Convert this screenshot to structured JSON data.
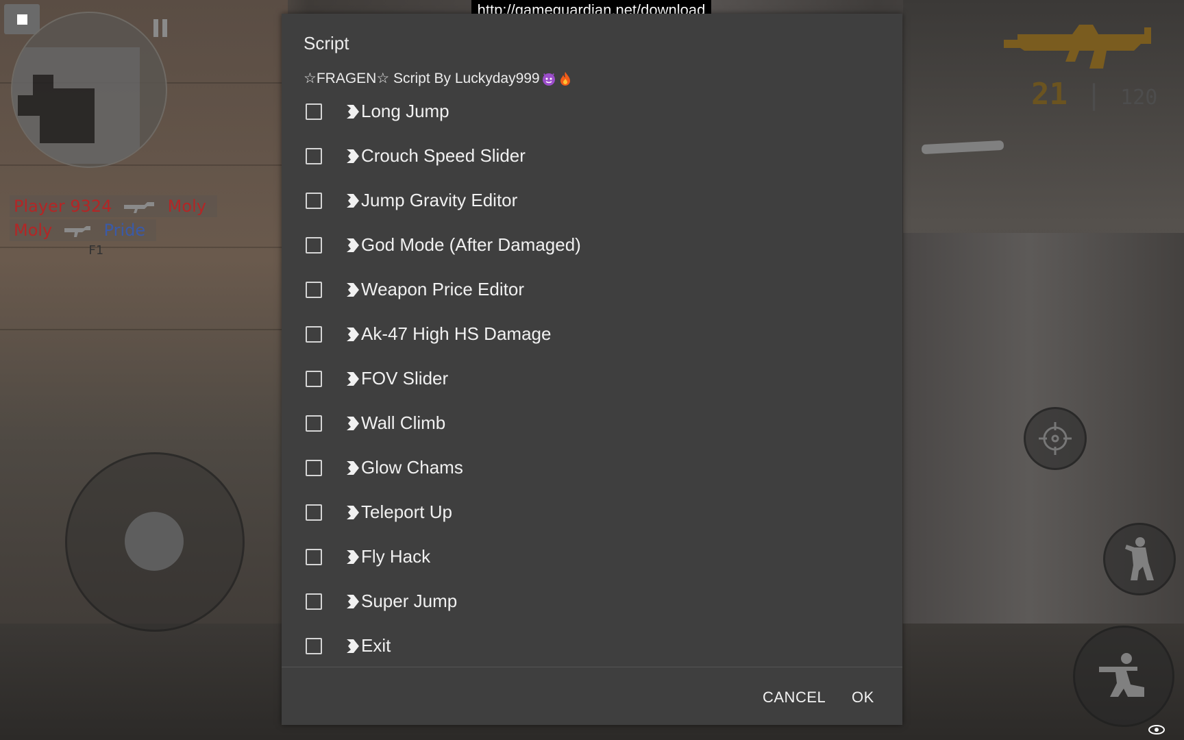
{
  "overlay": {
    "url": "http://gameguardian.net/download"
  },
  "hud": {
    "killfeed": [
      {
        "killer": "Player 9324",
        "victim": "Moly"
      },
      {
        "killer": "Moly",
        "victim": "Pride"
      }
    ],
    "killfeed_tag": "F1",
    "ammo": {
      "magazine": "21",
      "separator": "|",
      "reserve": "120"
    },
    "colors": {
      "team_red": "#b32626",
      "team_blue": "#3a5aa8",
      "ammo": "#6b5420"
    }
  },
  "dialog": {
    "title": "Script",
    "subtitle": "☆FRAGEN☆ Script By Luckyday999",
    "subtitle_icons": [
      "devil-emoji-icon",
      "fire-emoji-icon"
    ],
    "items": [
      {
        "label": "Long Jump",
        "checked": false
      },
      {
        "label": "Crouch Speed Slider",
        "checked": false
      },
      {
        "label": "Jump Gravity Editor",
        "checked": false
      },
      {
        "label": "God Mode (After Damaged)",
        "checked": false
      },
      {
        "label": "Weapon Price Editor",
        "checked": false
      },
      {
        "label": "Ak-47 High HS Damage",
        "checked": false
      },
      {
        "label": "FOV Slider",
        "checked": false
      },
      {
        "label": "Wall Climb",
        "checked": false
      },
      {
        "label": "Glow Chams",
        "checked": false
      },
      {
        "label": "Teleport Up",
        "checked": false
      },
      {
        "label": "Fly Hack",
        "checked": false
      },
      {
        "label": "Super Jump",
        "checked": false
      },
      {
        "label": "Exit",
        "checked": false
      }
    ],
    "item_icon": "arrow-bullet-icon",
    "buttons": {
      "cancel": "CANCEL",
      "ok": "OK"
    }
  }
}
